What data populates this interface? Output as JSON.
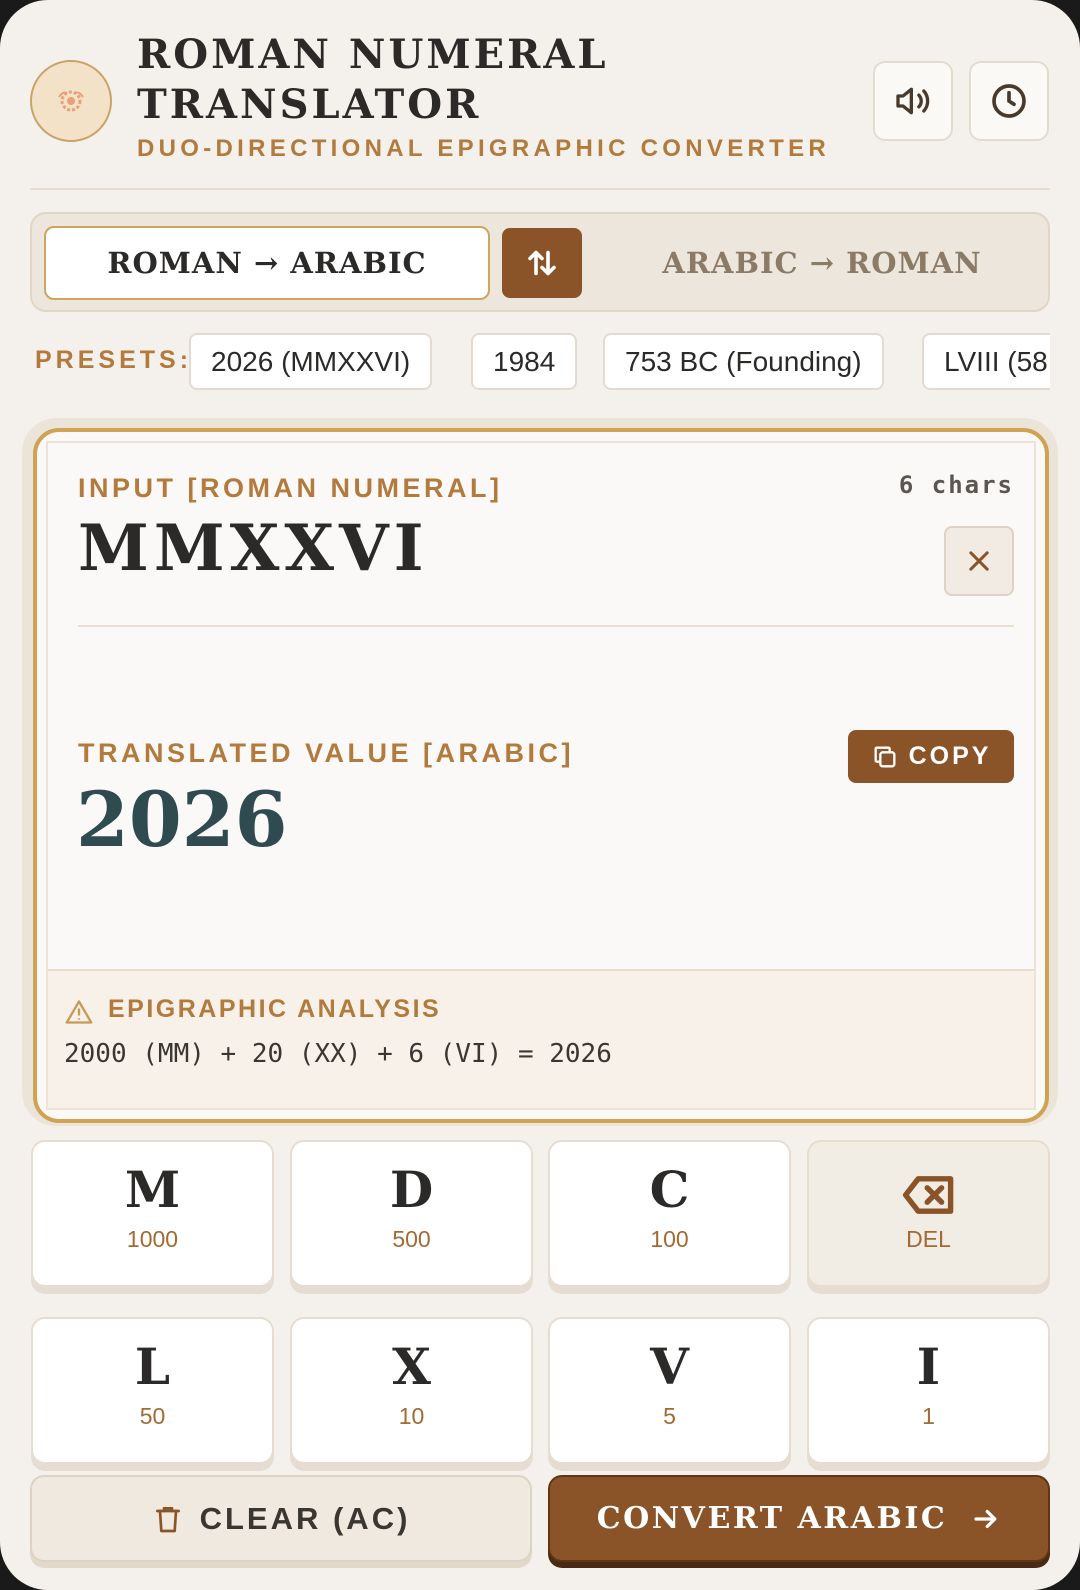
{
  "header": {
    "title": "ROMAN NUMERAL TRANSLATOR",
    "subtitle": "DUO-DIRECTIONAL EPIGRAPHIC CONVERTER",
    "logo_icon": "laurel-emblem-icon",
    "sound_icon": "speaker-icon",
    "history_icon": "clock-icon"
  },
  "mode": {
    "active": "ROMAN → ARABIC",
    "inactive": "ARABIC → ROMAN",
    "swap_icon": "swap-arrows-icon"
  },
  "presets": {
    "label": "PRESETS:",
    "items": [
      "2026 (MMXXVI)",
      "1984",
      "753 BC (Founding)",
      "LVIII (58"
    ]
  },
  "input": {
    "label": "INPUT [ROMAN NUMERAL]",
    "char_count": "6 chars",
    "value": "MMXXVI"
  },
  "output": {
    "label": "TRANSLATED VALUE [ARABIC]",
    "copy_label": "COPY",
    "value": "2026"
  },
  "analysis": {
    "title": "EPIGRAPHIC ANALYSIS",
    "expression": "2000 (MM) + 20 (XX) + 6 (VI) = 2026"
  },
  "keypad": {
    "keys": [
      {
        "glyph": "M",
        "value": "1000"
      },
      {
        "glyph": "D",
        "value": "500"
      },
      {
        "glyph": "C",
        "value": "100"
      },
      {
        "glyph": "",
        "value": "DEL"
      },
      {
        "glyph": "L",
        "value": "50"
      },
      {
        "glyph": "X",
        "value": "10"
      },
      {
        "glyph": "V",
        "value": "5"
      },
      {
        "glyph": "I",
        "value": "1"
      }
    ]
  },
  "actions": {
    "clear_label": "CLEAR (AC)",
    "convert_label": "CONVERT ARABIC"
  },
  "colors": {
    "accent": "#8a5428",
    "gold": "#b27a3d",
    "result": "#2f4b4f",
    "background": "#f4f1ec"
  }
}
